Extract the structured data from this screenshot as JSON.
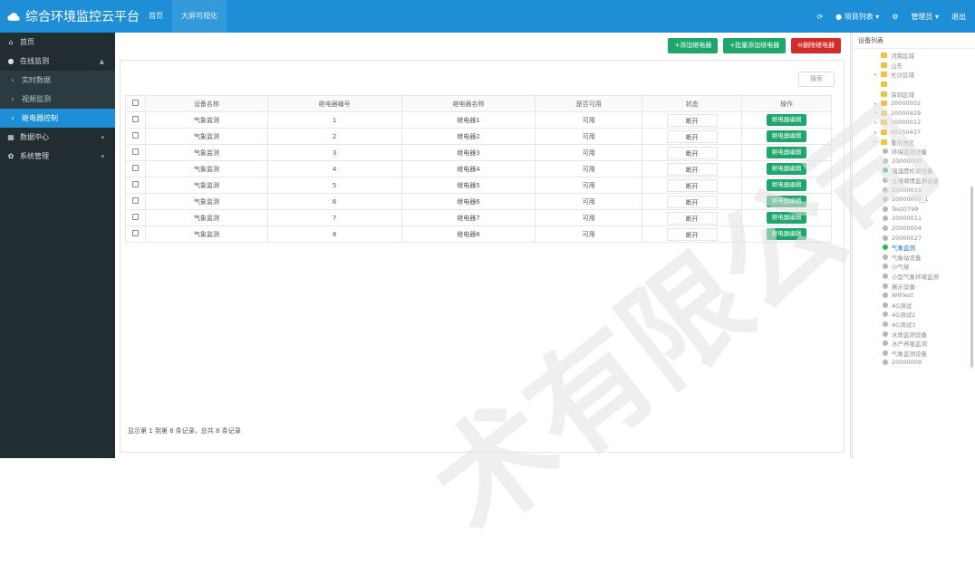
{
  "app": {
    "title": "综合环境监控云平台",
    "nav_tabs": [
      "首页",
      "大屏可视化"
    ],
    "top_right": {
      "refresh_icon": "refresh-icon",
      "item1": "● 项目列表 ▾",
      "item2": "管理员 ▾",
      "item3": "退出"
    }
  },
  "sidebar": {
    "items": [
      {
        "icon": "home-icon",
        "label": "首页",
        "type": "top"
      },
      {
        "icon": "dot-icon",
        "label": "在线监测",
        "type": "top",
        "arrow": "▲"
      },
      {
        "icon": "chevron-right-icon",
        "label": "实时数据",
        "type": "sub"
      },
      {
        "icon": "chevron-right-icon",
        "label": "视频监测",
        "type": "sub"
      },
      {
        "icon": "chevron-right-icon",
        "label": "继电器控制",
        "type": "sub",
        "selected": true
      },
      {
        "icon": "calendar-icon",
        "label": "数据中心",
        "type": "top",
        "arrow": "▾"
      },
      {
        "icon": "gear-icon",
        "label": "系统管理",
        "type": "top",
        "arrow": "▾"
      }
    ]
  },
  "toolbar": {
    "add_label": "+添加继电器",
    "batch_add_label": "+批量添加继电器",
    "delete_label": "⊖删除继电器"
  },
  "search": {
    "placeholder": "搜索"
  },
  "table": {
    "headers": [
      "设备名称",
      "继电器编号",
      "继电器名称",
      "是否可用",
      "状态",
      "操作"
    ],
    "rows": [
      {
        "device": "气象监测",
        "num": "1",
        "name": "继电器1",
        "avail": "可用",
        "state": "断开",
        "op": "继电器编辑"
      },
      {
        "device": "气象监测",
        "num": "2",
        "name": "继电器2",
        "avail": "可用",
        "state": "断开",
        "op": "继电器编辑"
      },
      {
        "device": "气象监测",
        "num": "3",
        "name": "继电器3",
        "avail": "可用",
        "state": "断开",
        "op": "继电器编辑"
      },
      {
        "device": "气象监测",
        "num": "4",
        "name": "继电器4",
        "avail": "可用",
        "state": "断开",
        "op": "继电器编辑"
      },
      {
        "device": "气象监测",
        "num": "5",
        "name": "继电器5",
        "avail": "可用",
        "state": "断开",
        "op": "继电器编辑"
      },
      {
        "device": "气象监测",
        "num": "6",
        "name": "继电器6",
        "avail": "可用",
        "state": "断开",
        "op": "继电器编辑"
      },
      {
        "device": "气象监测",
        "num": "7",
        "name": "继电器7",
        "avail": "可用",
        "state": "断开",
        "op": "继电器编辑"
      },
      {
        "device": "气象监测",
        "num": "8",
        "name": "继电器8",
        "avail": "可用",
        "state": "断开",
        "op": "继电器编辑"
      }
    ]
  },
  "footer": {
    "text": "显示第 1 到第 8 条记录，总共 8 条记录"
  },
  "device_list": {
    "title": "设备列表",
    "nodes": [
      {
        "type": "folder",
        "label": "河南区域",
        "caret": ""
      },
      {
        "type": "folder",
        "label": "山东",
        "caret": ""
      },
      {
        "type": "folder",
        "label": "长沙区域",
        "caret": "▸"
      },
      {
        "type": "folder",
        "label": "",
        "caret": ""
      },
      {
        "type": "folder",
        "label": "深圳区域",
        "caret": ""
      },
      {
        "type": "folder",
        "label": "20000002",
        "caret": "▸"
      },
      {
        "type": "folder",
        "label": "20000429",
        "caret": "▸"
      },
      {
        "type": "folder",
        "label": "20000012",
        "caret": "▸"
      },
      {
        "type": "folder",
        "label": "40150437",
        "caret": "▸"
      },
      {
        "type": "folder",
        "label": "重庆地区",
        "caret": "▸"
      },
      {
        "type": "device",
        "label": "环境监测设备",
        "caret": ""
      },
      {
        "type": "device",
        "label": "20000000",
        "caret": ""
      },
      {
        "type": "online",
        "label": "温湿度检测设备",
        "caret": ""
      },
      {
        "type": "device",
        "label": "土壤墒情监测设备",
        "caret": ""
      },
      {
        "type": "device",
        "label": "20000011",
        "caret": ""
      },
      {
        "type": "device",
        "label": "20000007_1",
        "caret": ""
      },
      {
        "type": "device",
        "label": "Test0799",
        "caret": ""
      },
      {
        "type": "device",
        "label": "20000011",
        "caret": ""
      },
      {
        "type": "device",
        "label": "20000004",
        "caret": ""
      },
      {
        "type": "device",
        "label": "20000027",
        "caret": ""
      },
      {
        "type": "online",
        "label": "气象监测",
        "caret": "",
        "highlight": true
      },
      {
        "type": "device",
        "label": "气象站设备",
        "caret": ""
      },
      {
        "type": "device",
        "label": "小气候",
        "caret": ""
      },
      {
        "type": "device",
        "label": "小型气象环境监测",
        "caret": ""
      },
      {
        "type": "device",
        "label": "展示设备",
        "caret": ""
      },
      {
        "type": "device",
        "label": "WIFIest",
        "caret": ""
      },
      {
        "type": "device",
        "label": "4G测试",
        "caret": ""
      },
      {
        "type": "device",
        "label": "4G测试2",
        "caret": ""
      },
      {
        "type": "device",
        "label": "4G测试3",
        "caret": ""
      },
      {
        "type": "device",
        "label": "水质监测设备",
        "caret": ""
      },
      {
        "type": "device",
        "label": "水产养殖监测",
        "caret": ""
      },
      {
        "type": "device",
        "label": "气象监测设备",
        "caret": ""
      },
      {
        "type": "device",
        "label": "20000009",
        "caret": ""
      }
    ]
  },
  "colors": {
    "brand": "#1e8fd6",
    "sidebar": "#222d32",
    "green": "#1ea76c",
    "red": "#d52c2a"
  }
}
